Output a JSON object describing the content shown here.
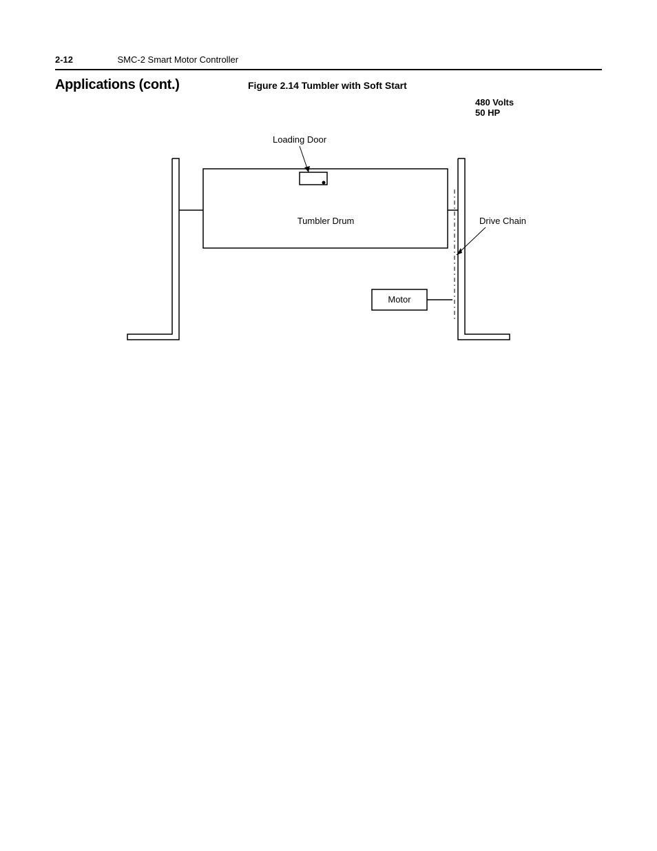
{
  "header": {
    "page_number": "2-12",
    "title": "SMC-2 Smart Motor Controller"
  },
  "section_title": "Applications (cont.)",
  "figure_caption": "Figure 2.14 Tumbler with Soft Start",
  "rating": {
    "volts": "480 Volts",
    "hp": "50 HP"
  },
  "diagram": {
    "loading_door": "Loading Door",
    "tumbler_drum": "Tumbler Drum",
    "drive_chain": "Drive Chain",
    "motor": "Motor"
  }
}
